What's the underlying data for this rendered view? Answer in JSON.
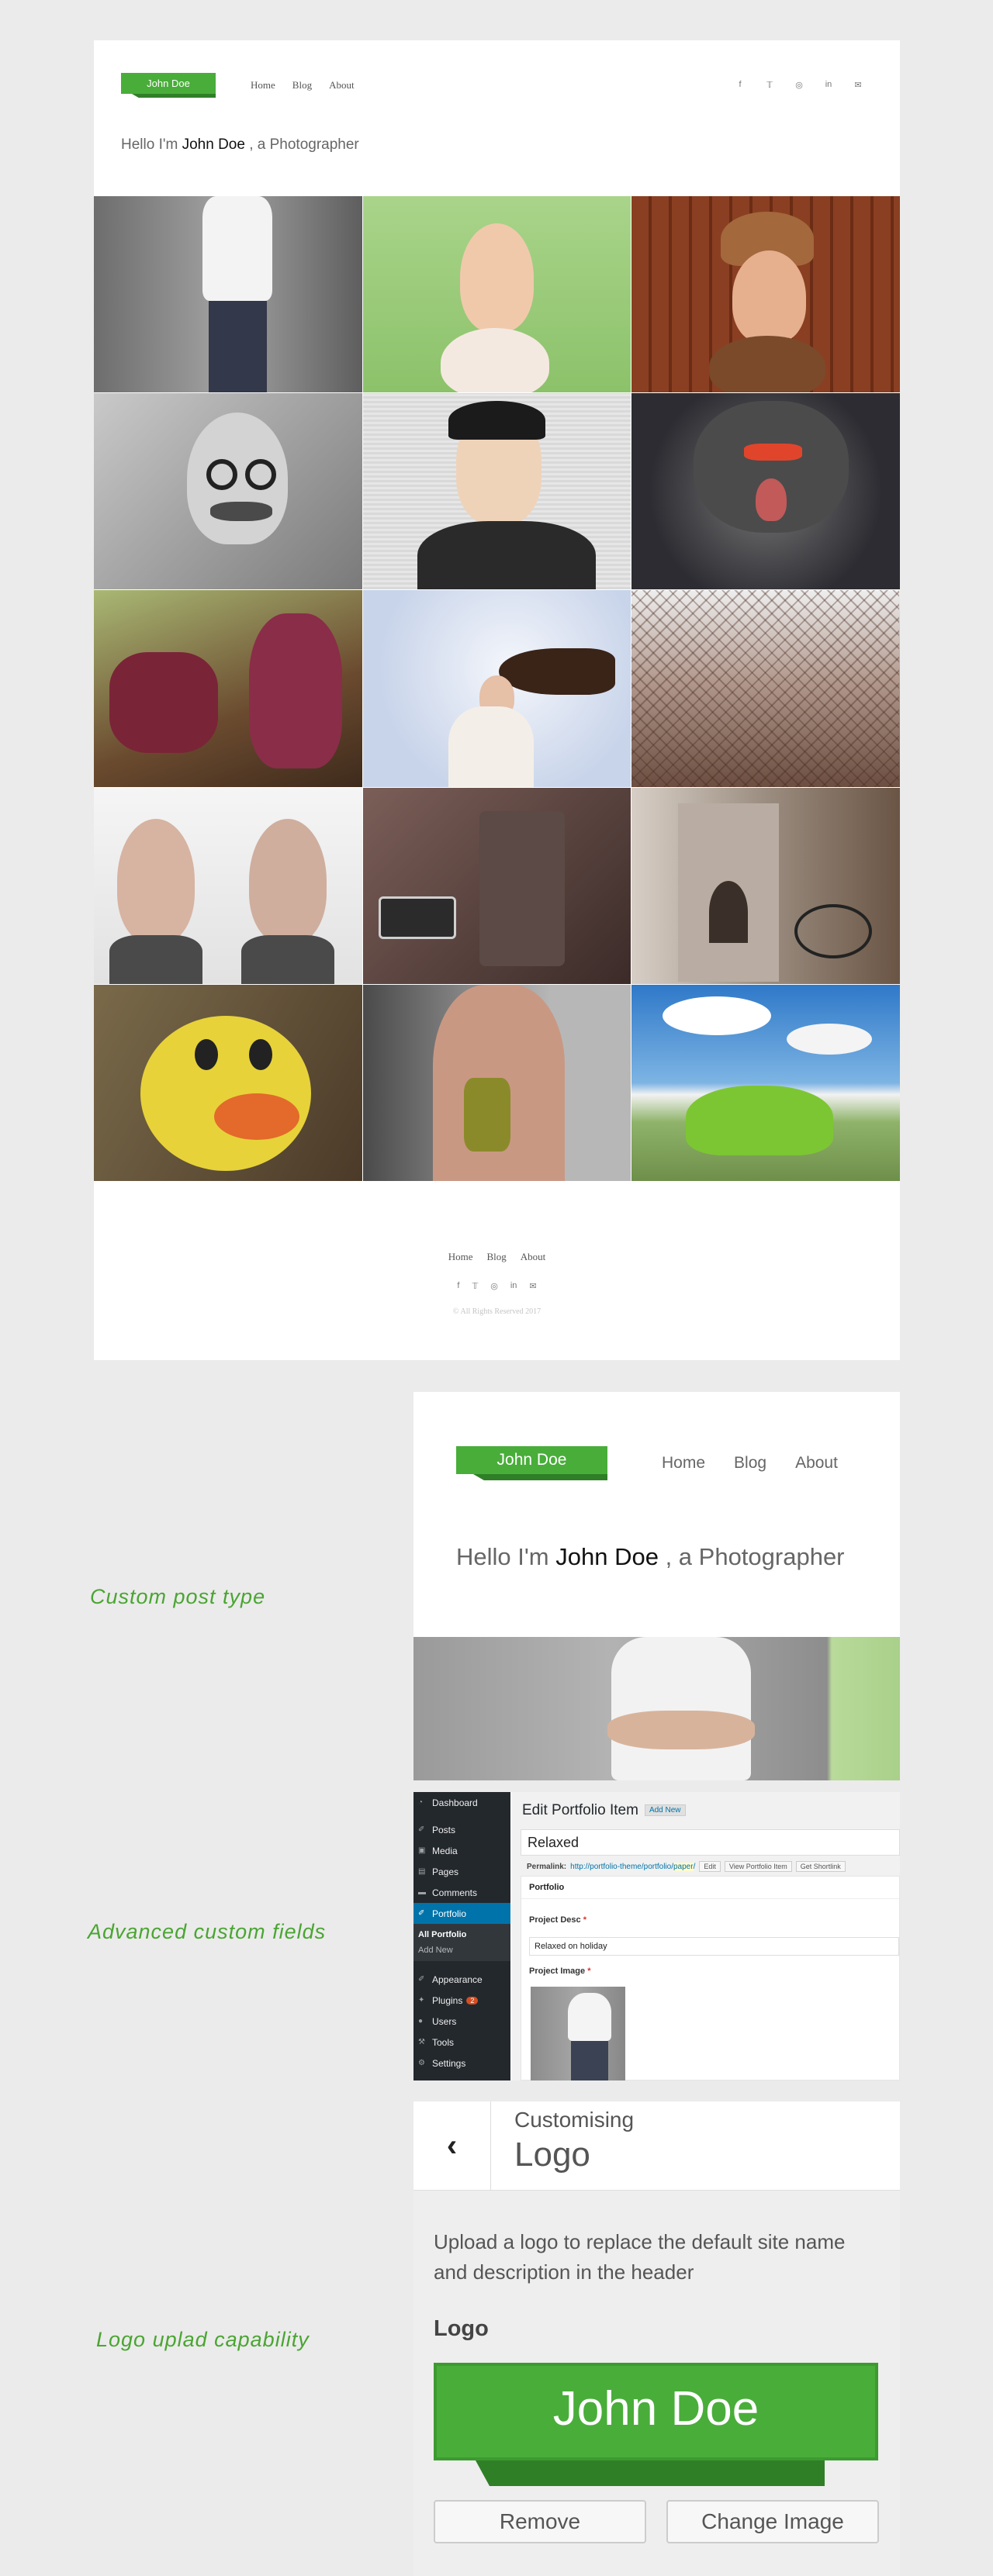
{
  "site": {
    "logo": "John Doe",
    "nav": [
      "Home",
      "Blog",
      "About"
    ],
    "social_icons": [
      "facebook-icon",
      "twitter-icon",
      "github-icon",
      "linkedin-icon",
      "envelope-icon"
    ],
    "hello_prefix": "Hello I'm ",
    "hello_name": "John Doe",
    "hello_suffix": " , a Photographer",
    "footer_nav": [
      "Home",
      "Blog",
      "About"
    ],
    "copyright": "© All Rights Reserved 2017"
  },
  "features": {
    "custom_post_type": "Custom post type",
    "advanced_custom_fields": "Advanced custom fields",
    "logo_upload": "Logo uplad capability"
  },
  "panel1": {
    "logo": "John Doe",
    "nav": [
      "Home",
      "Blog",
      "About"
    ],
    "hello_prefix": "Hello I'm ",
    "hello_name": "John Doe",
    "hello_suffix": " , a Photographer"
  },
  "wp": {
    "menu": [
      {
        "icon": "dashboard-icon",
        "label": "Dashboard"
      },
      {
        "icon": "pin-icon",
        "label": "Posts"
      },
      {
        "icon": "media-icon",
        "label": "Media"
      },
      {
        "icon": "pages-icon",
        "label": "Pages"
      },
      {
        "icon": "comments-icon",
        "label": "Comments"
      },
      {
        "icon": "pin-icon",
        "label": "Portfolio"
      }
    ],
    "submenu": [
      "All Portfolio",
      "Add New"
    ],
    "menu2": [
      {
        "icon": "appearance-icon",
        "label": "Appearance"
      },
      {
        "icon": "plugins-icon",
        "label": "Plugins",
        "badge": "2"
      },
      {
        "icon": "users-icon",
        "label": "Users"
      },
      {
        "icon": "tools-icon",
        "label": "Tools"
      },
      {
        "icon": "settings-icon",
        "label": "Settings"
      }
    ],
    "title": "Edit Portfolio Item",
    "add_new": "Add New",
    "post_title": "Relaxed",
    "permalink_label": "Permalink:",
    "permalink_url": "http://portfolio-theme/portfolio/",
    "permalink_slug": "paper",
    "permalink_end": "/",
    "buttons": [
      "Edit",
      "View Portfolio Item",
      "Get Shortlink"
    ],
    "box_title": "Portfolio",
    "desc_label": "Project Desc",
    "desc_value": "Relaxed on holiday",
    "image_label": "Project Image",
    "required_mark": "*"
  },
  "customizer": {
    "subtitle": "Customising",
    "title": "Logo",
    "description": "Upload a logo to replace the default site name and description in the header",
    "label": "Logo",
    "logo_text": "John Doe",
    "remove": "Remove",
    "change": "Change Image"
  },
  "colors": {
    "accent": "#49ad3a",
    "wp_admin_bar": "#23282d",
    "wp_active": "#0073aa"
  }
}
